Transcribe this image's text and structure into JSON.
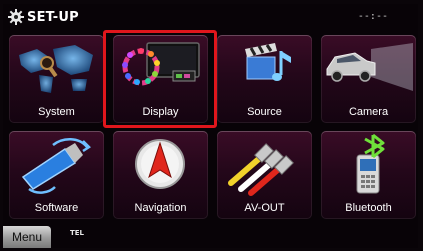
{
  "header": {
    "title": "SET-UP",
    "clock": "--:--",
    "icon": "gear-icon"
  },
  "tiles": [
    {
      "label": "System",
      "icon": "world-map-icon"
    },
    {
      "label": "Display",
      "icon": "display-icon",
      "selected": true
    },
    {
      "label": "Source",
      "icon": "clapper-music-icon"
    },
    {
      "label": "Camera",
      "icon": "car-camera-icon"
    },
    {
      "label": "Software",
      "icon": "usb-memory-icon"
    },
    {
      "label": "Navigation",
      "icon": "navigation-arrow-icon"
    },
    {
      "label": "AV-OUT",
      "icon": "rca-cables-icon"
    },
    {
      "label": "Bluetooth",
      "icon": "bluetooth-phone-icon"
    }
  ],
  "footer": {
    "menu_label": "Menu",
    "tel_label": "TEL"
  },
  "colors": {
    "selection_border": "#e0161c",
    "tile_bg": "#2a0a1e"
  }
}
